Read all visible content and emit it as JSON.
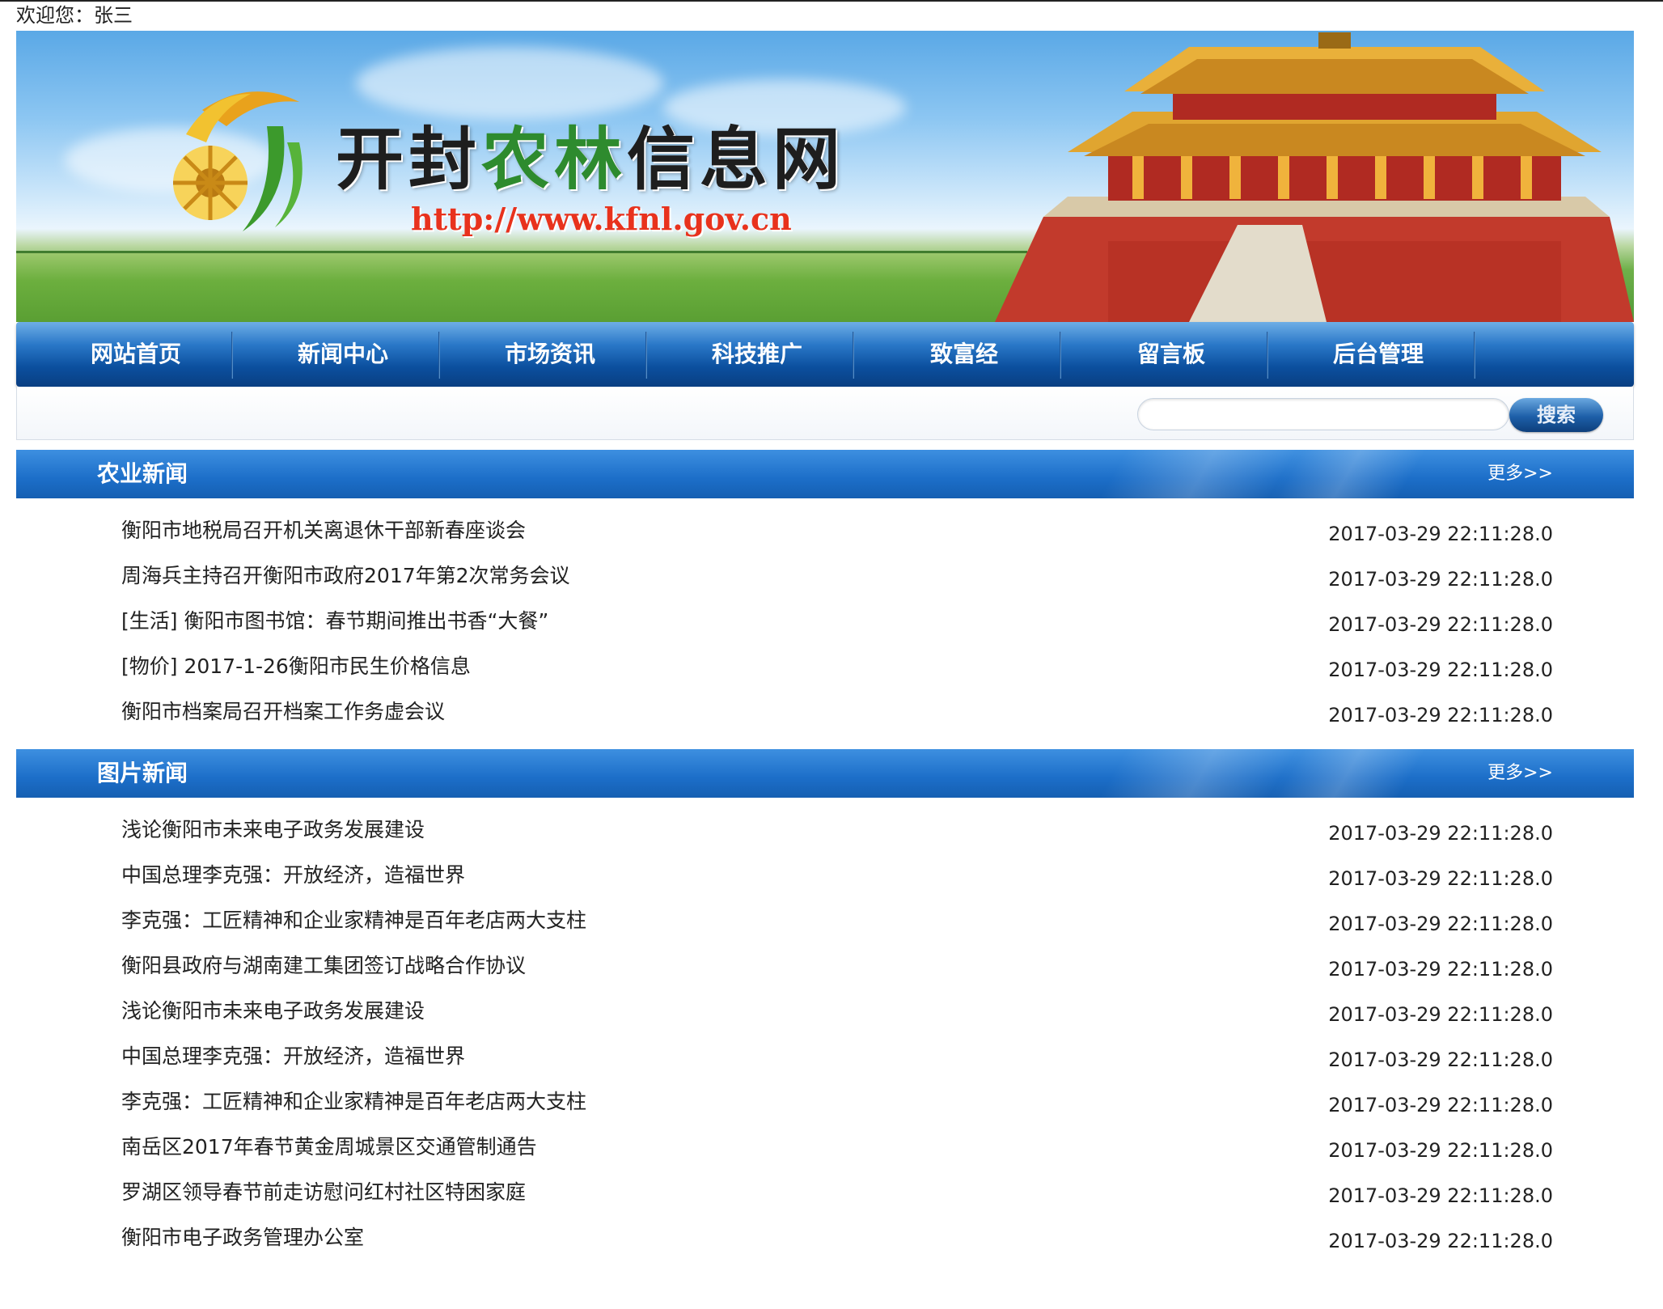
{
  "header": {
    "welcome": "欢迎您：张三"
  },
  "banner": {
    "title_part1": "开封",
    "title_part2": "农林",
    "title_part3": "信息网",
    "url": "http://www.kfnl.gov.cn"
  },
  "nav": {
    "items": [
      {
        "label": "网站首页"
      },
      {
        "label": "新闻中心"
      },
      {
        "label": "市场资讯"
      },
      {
        "label": "科技推广"
      },
      {
        "label": "致富经"
      },
      {
        "label": "留言板"
      },
      {
        "label": "后台管理"
      }
    ]
  },
  "search": {
    "input_value": "",
    "button_label": "搜索"
  },
  "sections": [
    {
      "title": "农业新闻",
      "more": "更多>>",
      "items": [
        {
          "title": "衡阳市地税局召开机关离退休干部新春座谈会",
          "date": "2017-03-29 22:11:28.0"
        },
        {
          "title": "周海兵主持召开衡阳市政府2017年第2次常务会议",
          "date": "2017-03-29 22:11:28.0"
        },
        {
          "title": "[生活] 衡阳市图书馆：春节期间推出书香“大餐”",
          "date": "2017-03-29 22:11:28.0"
        },
        {
          "title": "[物价] 2017-1-26衡阳市民生价格信息",
          "date": "2017-03-29 22:11:28.0"
        },
        {
          "title": "衡阳市档案局召开档案工作务虚会议",
          "date": "2017-03-29 22:11:28.0"
        }
      ]
    },
    {
      "title": "图片新闻",
      "more": "更多>>",
      "items": [
        {
          "title": "浅论衡阳市未来电子政务发展建设",
          "date": "2017-03-29 22:11:28.0"
        },
        {
          "title": "中国总理李克强：开放经济，造福世界",
          "date": "2017-03-29 22:11:28.0"
        },
        {
          "title": "李克强：工匠精神和企业家精神是百年老店两大支柱",
          "date": "2017-03-29 22:11:28.0"
        },
        {
          "title": "衡阳县政府与湖南建工集团签订战略合作协议",
          "date": "2017-03-29 22:11:28.0"
        },
        {
          "title": "浅论衡阳市未来电子政务发展建设",
          "date": "2017-03-29 22:11:28.0"
        },
        {
          "title": "中国总理李克强：开放经济，造福世界",
          "date": "2017-03-29 22:11:28.0"
        },
        {
          "title": "李克强：工匠精神和企业家精神是百年老店两大支柱",
          "date": "2017-03-29 22:11:28.0"
        },
        {
          "title": "南岳区2017年春节黄金周城景区交通管制通告",
          "date": "2017-03-29 22:11:28.0"
        },
        {
          "title": "罗湖区领导春节前走访慰问红村社区特困家庭",
          "date": "2017-03-29 22:11:28.0"
        },
        {
          "title": "衡阳市电子政务管理办公室",
          "date": "2017-03-29 22:11:28.0"
        }
      ]
    }
  ]
}
